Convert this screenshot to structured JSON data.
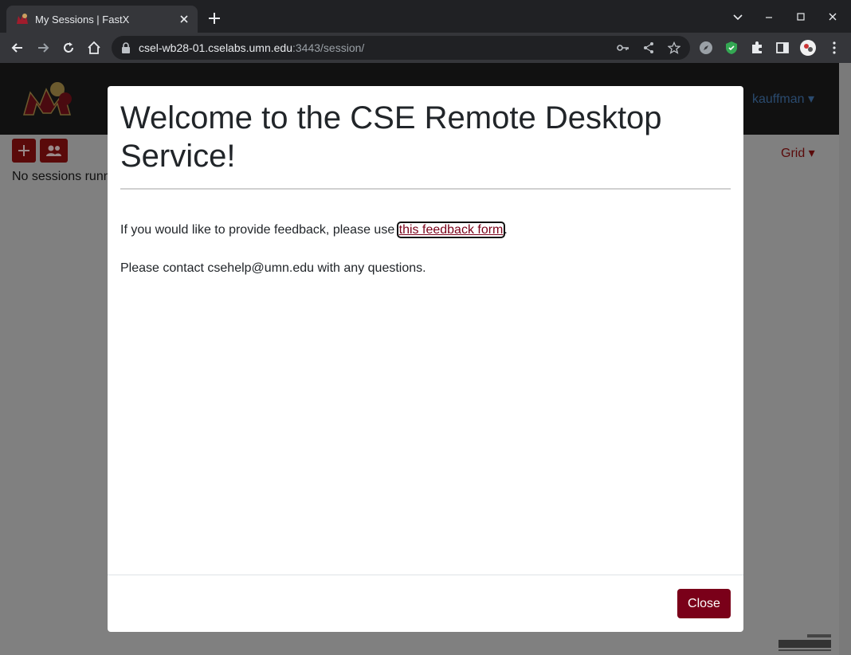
{
  "browser": {
    "tab_title": "My Sessions | FastX",
    "url_host": "csel-wb28-01.cselabs.umn.edu",
    "url_path": ":3443/session/"
  },
  "app": {
    "user_menu_label": "kauffman",
    "no_sessions_text": "No sessions runn",
    "add_session_label": "+",
    "view_menu_label": "Grid"
  },
  "modal": {
    "title": "Welcome to the CSE Remote Desktop Service!",
    "feedback_prefix": "If you would like to provide feedback, please use ",
    "feedback_link": "this feedback form",
    "feedback_suffix": ".",
    "contact_text": "Please contact csehelp@umn.edu with any questions.",
    "close_label": "Close"
  },
  "colors": {
    "brand_maroon": "#7a0019",
    "chrome_dark": "#202124",
    "chrome_toolbar": "#35363a",
    "backdrop": "#808080"
  },
  "icons": [
    "umn-logo-icon",
    "close-icon",
    "plus-icon",
    "back-icon",
    "forward-icon",
    "reload-icon",
    "home-icon",
    "lock-icon",
    "key-icon",
    "share-icon",
    "star-icon",
    "extension-icon",
    "sidebar-icon",
    "avatar",
    "more-icon",
    "users-icon",
    "starnet-logo"
  ]
}
